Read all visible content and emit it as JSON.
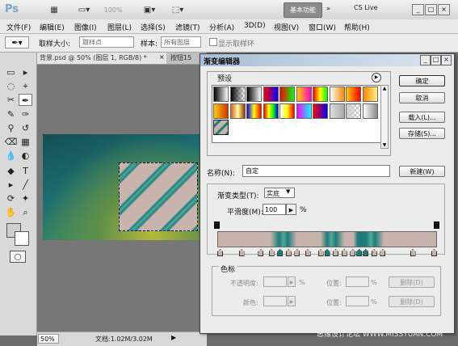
{
  "app": {
    "logo": "Ps",
    "zoom": "100%",
    "workspace": "基本功能",
    "cslive": "CS Live",
    "window_controls": [
      "_",
      "□",
      "×"
    ]
  },
  "menu": [
    "文件(F)",
    "编辑(E)",
    "图像(I)",
    "图层(L)",
    "选择(S)",
    "滤镜(T)",
    "分析(A)",
    "3D(D)",
    "视图(V)",
    "窗口(W)",
    "帮助(H)"
  ],
  "options": {
    "sample_size_label": "取样大小:",
    "sample_size_value": "取样点",
    "sample_label": "样本:",
    "sample_value": "所有图层",
    "show_ring": "显示取样环"
  },
  "document": {
    "tab_active": "背景.psd @ 50% (图层 1, RGB/8) *",
    "tab_close": "×",
    "tab_second": "按钮15",
    "zoom": "50%",
    "doc_size": "文档:1.02M/3.02M",
    "arrow": "▶"
  },
  "dialog": {
    "title": "渐变编辑器",
    "presets_label": "预设",
    "ok": "确定",
    "cancel": "取消",
    "load": "载入(L)...",
    "save": "存储(S)...",
    "name_label": "名称(N):",
    "name_value": "自定",
    "new_button": "新建(W)",
    "gradient_type_label": "渐变类型(T):",
    "gradient_type_value": "实底",
    "smoothness_label": "平滑度(M):",
    "smoothness_value": "100",
    "smoothness_unit": "%",
    "color_stops_label": "色标",
    "opacity_label": "不透明度:",
    "opacity_unit": "%",
    "location_label": "位置:",
    "location_unit": "%",
    "delete_label": "删除(D)",
    "color_label": "颜色:",
    "location2_label": "位置:",
    "location2_unit": "%",
    "delete2_label": "删除(D)",
    "accent_teal": "#1d7d7b",
    "accent_rose": "#c8b3ad",
    "preset_swatches": [
      [
        "#000000,#ffffff",
        "#000000,transparent",
        "#000000,#ffffff",
        "#ff0000,#0000ff",
        "#ff0000,#00ff00",
        "#ffcc00,#ff00cc",
        "#ff0000,#ffff00,#00ff00",
        "#ffffff,#ff8800",
        "#ffcc00,#ff0000",
        "#ff8800,#ffee88"
      ],
      [
        "#ffcc00,#cc3300",
        "#cc6633,#ffff99,#993300",
        "#0000ff,#ffff00,#ff0000",
        "#ff0000,#ffff00,#00ff00,#0000ff",
        "#ffffff,#ffff00,#ff0000",
        "#ff00ff,#00ffff",
        "#ff0000,#0000ff",
        "#dddddd,#aaaaaa",
        "#cccccc,transparent",
        "#ffffff,#888888"
      ],
      [
        "#1d7d7b,#c8b3ad"
      ]
    ]
  },
  "tools": [
    "▭",
    "▸",
    "◌",
    "⌖",
    "✂",
    "✎",
    "✑",
    "⌫",
    "▦",
    "◐",
    "◆",
    "T",
    "✦",
    "⬜",
    "✋",
    "🔍"
  ],
  "watermark": "思缘设计论坛  WWW.MISSYUAN.COM"
}
